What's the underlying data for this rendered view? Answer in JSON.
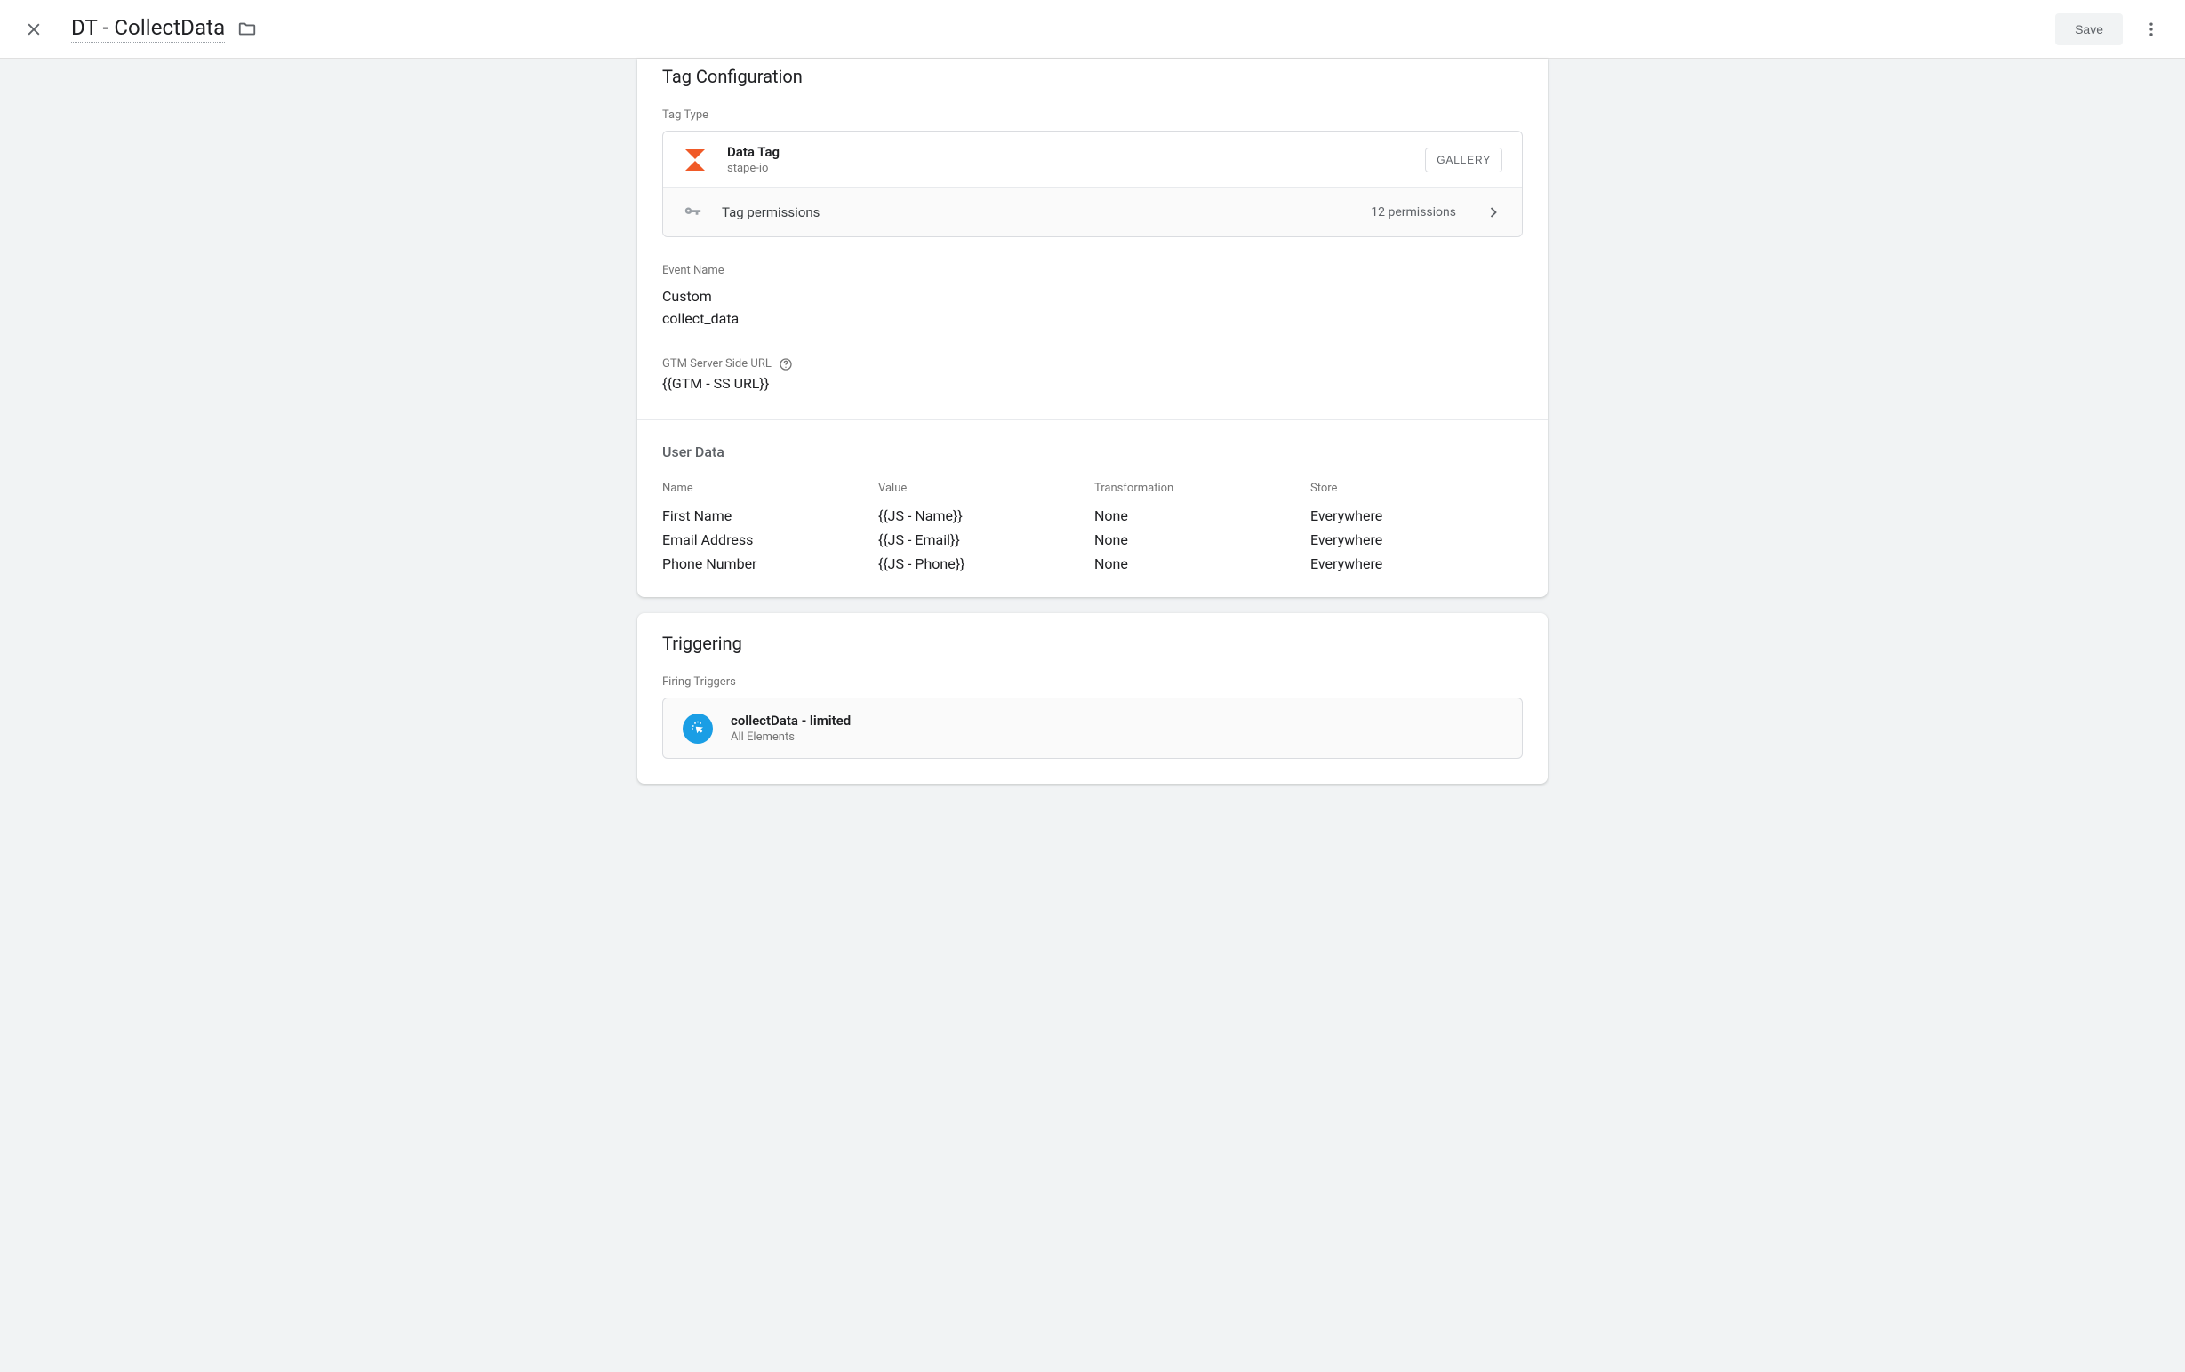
{
  "header": {
    "title": "DT - CollectData",
    "save_label": "Save"
  },
  "config": {
    "section_title": "Tag Configuration",
    "tag_type_label": "Tag Type",
    "tag_name": "Data Tag",
    "tag_vendor": "stape-io",
    "gallery_label": "GALLERY",
    "permissions_label": "Tag permissions",
    "permissions_count": "12 permissions",
    "event_name_label": "Event Name",
    "event_name_type": "Custom",
    "event_name_value": "collect_data",
    "server_url_label": "GTM Server Side URL",
    "server_url_value": "{{GTM - SS URL}}",
    "user_data_title": "User Data",
    "cols": {
      "name": "Name",
      "value": "Value",
      "transform": "Transformation",
      "store": "Store"
    },
    "rows": [
      {
        "name": "First Name",
        "value": "{{JS - Name}}",
        "transform": "None",
        "store": "Everywhere"
      },
      {
        "name": "Email Address",
        "value": "{{JS - Email}}",
        "transform": "None",
        "store": "Everywhere"
      },
      {
        "name": "Phone Number",
        "value": "{{JS - Phone}}",
        "transform": "None",
        "store": "Everywhere"
      }
    ]
  },
  "trigger": {
    "section_title": "Triggering",
    "firing_label": "Firing Triggers",
    "name": "collectData - limited",
    "sub": "All Elements"
  }
}
